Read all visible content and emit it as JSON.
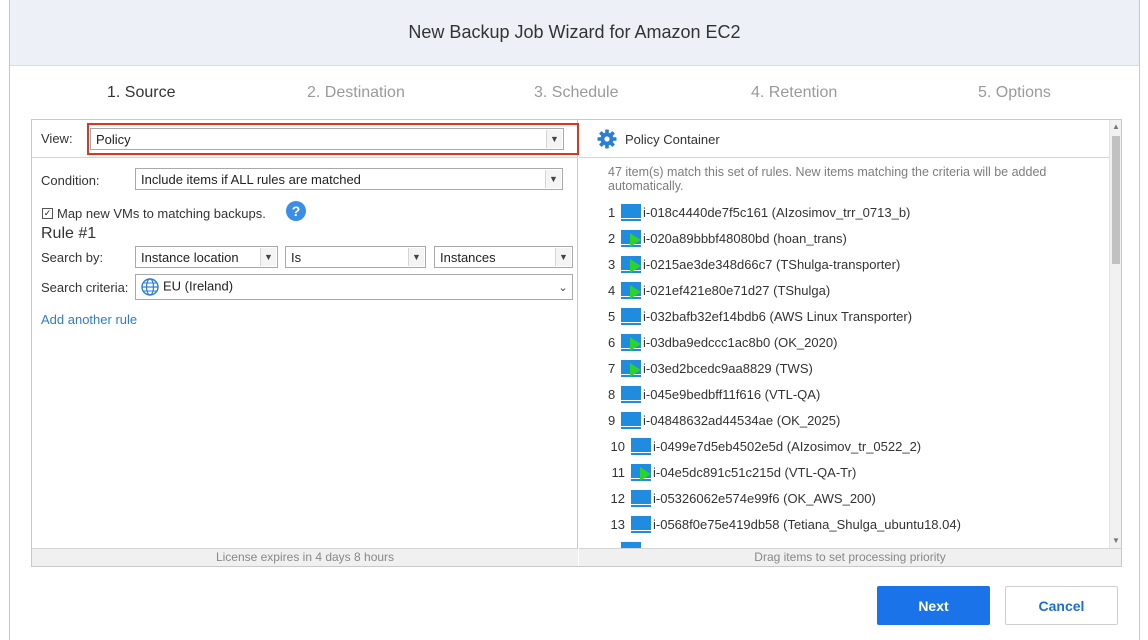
{
  "window": {
    "title": "New Backup Job Wizard for Amazon EC2"
  },
  "steps": [
    {
      "label": "1. Source",
      "active": true
    },
    {
      "label": "2. Destination",
      "active": false
    },
    {
      "label": "3. Schedule",
      "active": false
    },
    {
      "label": "4. Retention",
      "active": false
    },
    {
      "label": "5. Options",
      "active": false
    }
  ],
  "left": {
    "view_label": "View:",
    "view_value": "Policy",
    "condition_label": "Condition:",
    "condition_value": "Include items if ALL rules are matched",
    "map_vms_label": "Map new VMs to matching backups.",
    "map_vms_checked": true,
    "rule_title": "Rule #1",
    "search_by_label": "Search by:",
    "search_by_value": "Instance location",
    "operator_value": "Is",
    "target_value": "Instances",
    "criteria_label": "Search criteria:",
    "criteria_value": "EU (Ireland)",
    "add_rule_link": "Add another rule",
    "footer": "License expires in 4 days 8 hours"
  },
  "right": {
    "container_title": "Policy Container",
    "match_text": "47 item(s) match this set of rules. New items matching the criteria will be added automatically.",
    "footer": "Drag items to set processing priority",
    "items": [
      {
        "num": "1",
        "label": "i-018c4440de7f5c161 (AIzosimov_trr_0713_b)",
        "transporter": false
      },
      {
        "num": "2",
        "label": "i-020a89bbbf48080bd (hoan_trans)",
        "transporter": true
      },
      {
        "num": "3",
        "label": "i-0215ae3de348d66c7 (TShulga-transporter)",
        "transporter": true
      },
      {
        "num": "4",
        "label": "i-021ef421e80e71d27 (TShulga)",
        "transporter": true
      },
      {
        "num": "5",
        "label": "i-032bafb32ef14bdb6 (AWS Linux Transporter)",
        "transporter": false
      },
      {
        "num": "6",
        "label": "i-03dba9edccc1ac8b0 (OK_2020)",
        "transporter": true
      },
      {
        "num": "7",
        "label": "i-03ed2bcedc9aa8829 (TWS)",
        "transporter": true
      },
      {
        "num": "8",
        "label": "i-045e9bedbff11f616 (VTL-QA)",
        "transporter": false
      },
      {
        "num": "9",
        "label": "i-04848632ad44534ae (OK_2025)",
        "transporter": false
      },
      {
        "num": "10",
        "label": "i-0499e7d5eb4502e5d (AIzosimov_tr_0522_2)",
        "transporter": false
      },
      {
        "num": "11",
        "label": "i-04e5dc891c51c215d (VTL-QA-Tr)",
        "transporter": true
      },
      {
        "num": "12",
        "label": "i-05326062e574e99f6 (OK_AWS_200)",
        "transporter": false
      },
      {
        "num": "13",
        "label": "i-0568f0e75e419db58 (Tetiana_Shulga_ubuntu18.04)",
        "transporter": false
      },
      {
        "num": "",
        "label": "",
        "transporter": false
      }
    ]
  },
  "buttons": {
    "next": "Next",
    "cancel": "Cancel"
  },
  "colors": {
    "accent": "#1a73e8",
    "highlight": "#e0341f",
    "vm_icon": "#1f8ce0",
    "transporter": "#2bd32b"
  }
}
